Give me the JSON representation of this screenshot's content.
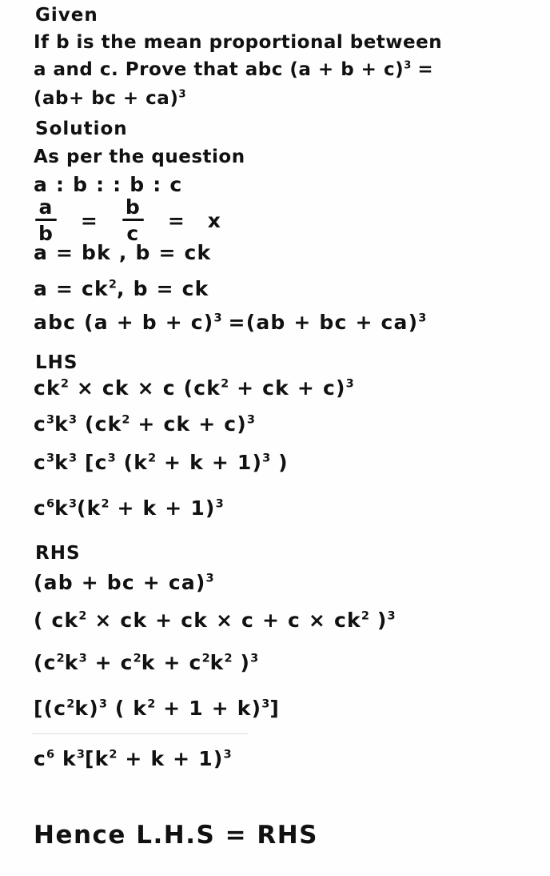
{
  "document": {
    "kind": "handwritten-math-solution",
    "background_color": "#fefefe",
    "ink_color": "#111111",
    "topic": "mean proportional identity proof"
  },
  "labels": {
    "given": "Given",
    "solution": "Solution",
    "as_per_question": "As per the question",
    "lhs": "LHS",
    "rhs": "RHS"
  },
  "problem": {
    "line1": "If b is the mean proportional between",
    "line2_pre": "a and c. Prove that abc (a + b + c)",
    "line2_exp": "3",
    "line2_post": "=",
    "line3_pre": "(ab+ bc + ca)",
    "line3_exp": "3"
  },
  "steps": {
    "proportion": "a : b : : b : c",
    "fraction": {
      "num1": "a",
      "den1": "b",
      "eq1": "=",
      "num2": "b",
      "den2": "c",
      "eq2": "=",
      "value": "x"
    },
    "sub1": "a = bk ,  b = ck",
    "sub2_pre": "a = ck",
    "sub2_exp": "2",
    "sub2_post": ",  b = ck",
    "identity": {
      "lhs_pre": "abc (a + b + c)",
      "lhs_exp": "3",
      "eq": "=",
      "rhs_pre": "(ab + bc + ca)",
      "rhs_exp": "3"
    }
  },
  "lhs_work": [
    {
      "id": "lhs-line-1",
      "parts": [
        {
          "t": "ck"
        },
        {
          "s": "2"
        },
        {
          "t": " × ck × c  (ck"
        },
        {
          "s": "2"
        },
        {
          "t": " + ck + c)"
        },
        {
          "s": "3"
        }
      ]
    },
    {
      "id": "lhs-line-2",
      "parts": [
        {
          "t": "c"
        },
        {
          "s": "3"
        },
        {
          "t": "k"
        },
        {
          "s": "3"
        },
        {
          "t": "  (ck"
        },
        {
          "s": "2"
        },
        {
          "t": " + ck + c)"
        },
        {
          "s": "3"
        }
      ]
    },
    {
      "id": "lhs-line-3",
      "parts": [
        {
          "t": "c"
        },
        {
          "s": "3"
        },
        {
          "t": "k"
        },
        {
          "s": "3"
        },
        {
          "t": " [c"
        },
        {
          "s": "3"
        },
        {
          "t": " (k"
        },
        {
          "s": "2"
        },
        {
          "t": " + k + 1)"
        },
        {
          "s": "3"
        },
        {
          "t": " )"
        }
      ]
    },
    {
      "id": "lhs-line-4",
      "parts": [
        {
          "t": "c"
        },
        {
          "s": "6"
        },
        {
          "t": "k"
        },
        {
          "s": "3"
        },
        {
          "t": "(k"
        },
        {
          "s": "2"
        },
        {
          "t": " + k + 1)"
        },
        {
          "s": "3"
        }
      ]
    }
  ],
  "rhs_work": [
    {
      "id": "rhs-line-1",
      "parts": [
        {
          "t": "(ab + bc + ca)"
        },
        {
          "s": "3"
        }
      ]
    },
    {
      "id": "rhs-line-2",
      "parts": [
        {
          "t": "( ck"
        },
        {
          "s": "2"
        },
        {
          "t": " × ck + ck × c  + c × ck"
        },
        {
          "s": "2"
        },
        {
          "t": " )"
        },
        {
          "s": "3"
        }
      ]
    },
    {
      "id": "rhs-line-3",
      "parts": [
        {
          "t": "(c"
        },
        {
          "s": "2"
        },
        {
          "t": "k"
        },
        {
          "s": "3"
        },
        {
          "t": " + c"
        },
        {
          "s": "2"
        },
        {
          "t": "k  + c"
        },
        {
          "s": "2"
        },
        {
          "t": "k"
        },
        {
          "s": "2"
        },
        {
          "t": " )"
        },
        {
          "s": "3"
        }
      ]
    },
    {
      "id": "rhs-line-4",
      "parts": [
        {
          "t": "[(c"
        },
        {
          "s": "2"
        },
        {
          "t": "k)"
        },
        {
          "s": "3"
        },
        {
          "t": " ( k"
        },
        {
          "s": "2"
        },
        {
          "t": " + 1 + k)"
        },
        {
          "s": "3"
        },
        {
          "t": "]"
        }
      ]
    },
    {
      "id": "rhs-line-5",
      "parts": [
        {
          "t": "c"
        },
        {
          "s": "6"
        },
        {
          "t": " k"
        },
        {
          "s": "3"
        },
        {
          "t": "[k"
        },
        {
          "s": "2"
        },
        {
          "t": " + k + 1)"
        },
        {
          "s": "3"
        }
      ]
    }
  ],
  "conclusion": "Hence L.H.S = RHS"
}
